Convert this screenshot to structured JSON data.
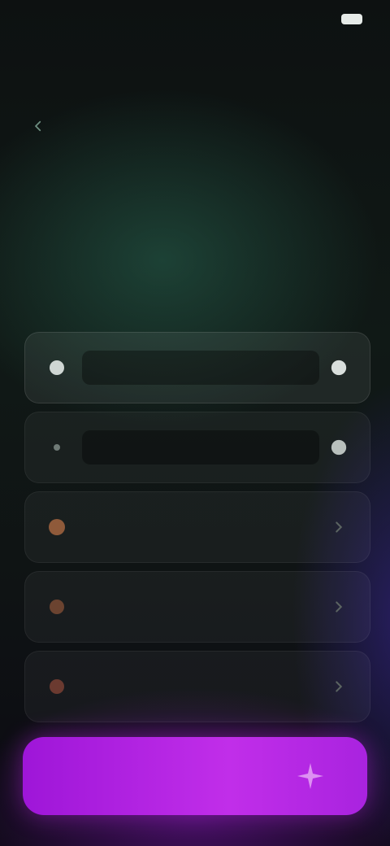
{
  "status_bar": {
    "time": "",
    "network": "",
    "signal": ""
  },
  "header": {
    "back_label": ""
  },
  "intro": {
    "kicker": "",
    "headline": "",
    "subtitle": ""
  },
  "options": [
    {
      "label": "",
      "lead_icon": "circle-icon",
      "trail_icon": "circle-icon",
      "selected": true
    },
    {
      "label": "",
      "lead_icon": "dot-icon",
      "trail_icon": "circle-icon",
      "selected": false
    },
    {
      "label": "",
      "lead_icon": "orange-icon",
      "trail_icon": "chevron-icon",
      "selected": false
    },
    {
      "label": "",
      "lead_icon": "orange-icon",
      "trail_icon": "chevron-icon",
      "selected": false
    },
    {
      "label": "",
      "lead_icon": "orange-icon",
      "trail_icon": "chevron-icon",
      "selected": false
    }
  ],
  "cta": {
    "label": "",
    "icon": "sparkle-icon"
  },
  "footer": {
    "text": ""
  },
  "colors": {
    "accent": "#b524e6",
    "accent_dark": "#9e16d8",
    "green_tint": "#2f6b55",
    "surface": "#1a1f1f",
    "text_primary": "#f1f3f2",
    "text_secondary": "#8d9794"
  }
}
